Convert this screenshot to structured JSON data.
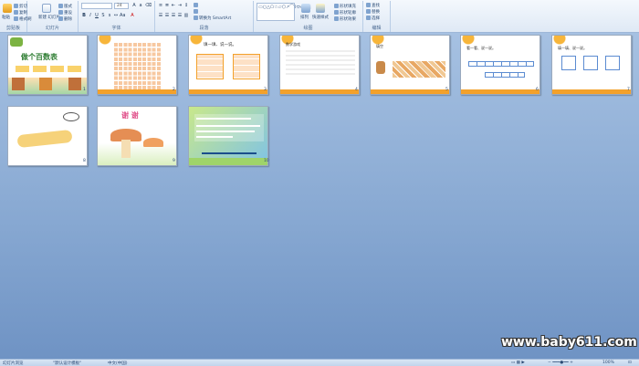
{
  "ribbon": {
    "groups": [
      {
        "label": "剪贴板"
      },
      {
        "label": "幻灯片"
      },
      {
        "label": "字体"
      },
      {
        "label": "段落"
      },
      {
        "label": "绘图"
      },
      {
        "label": "编辑"
      }
    ],
    "buttons": {
      "paste": "粘贴",
      "cut": "剪切",
      "copy": "复制",
      "format_painter": "格式刷",
      "new_slide": "新建\n幻灯片",
      "layout": "版式",
      "reset": "重设",
      "delete": "删除",
      "arrange": "排列",
      "quick_styles": "快速样式",
      "shape_fill": "形状填充",
      "shape_outline": "形状轮廓",
      "shape_effects": "形状效果",
      "find": "查找",
      "replace": "替换",
      "select": "选择",
      "convert_smartart": "转换为 SmartArt"
    },
    "font_size": "24",
    "font_name": ""
  },
  "slides": [
    {
      "number": "1",
      "title": "做个百数表"
    },
    {
      "number": "2",
      "title": ""
    },
    {
      "number": "3",
      "title": "填一填、说一说。"
    },
    {
      "number": "4",
      "title": "数学游戏"
    },
    {
      "number": "5",
      "title": "填空"
    },
    {
      "number": "6",
      "title": "看一看、说一说。"
    },
    {
      "number": "7",
      "title": "填一填、说一说。"
    },
    {
      "number": "8",
      "title": ""
    },
    {
      "number": "9",
      "title": "谢 谢"
    },
    {
      "number": "10",
      "title": ""
    }
  ],
  "status": {
    "view": "幻灯片浏览",
    "theme": "\"默认设计模板\"",
    "language": "中文(中国)",
    "zoom": "100%"
  },
  "watermark": "www.baby611.com",
  "colors": {
    "accent": "#f3a12b",
    "workspace": "#8fb0d8"
  }
}
